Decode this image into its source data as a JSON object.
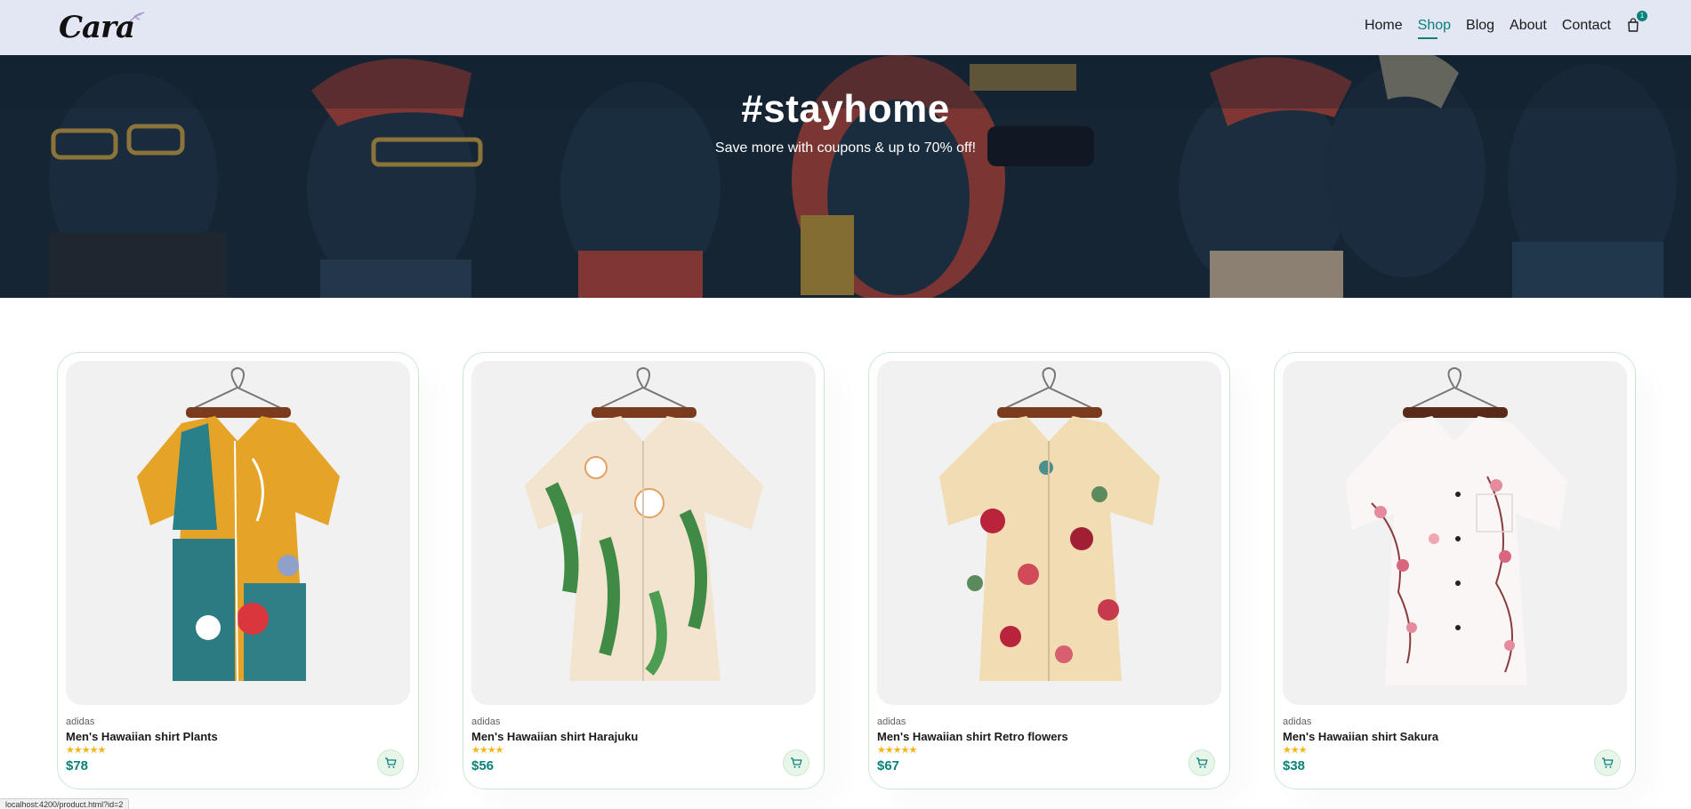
{
  "header": {
    "logo_text": "Cara",
    "nav": [
      "Home",
      "Shop",
      "Blog",
      "About",
      "Contact"
    ],
    "active_nav": "Shop",
    "cart_count": "1"
  },
  "hero": {
    "title": "#stayhome",
    "subtitle": "Save more with coupons & up to 70% off!"
  },
  "products": [
    {
      "brand": "adidas",
      "name": "Men's Hawaiian shirt Plants",
      "rating": 5,
      "stars": "★★★★★",
      "price": "$78"
    },
    {
      "brand": "adidas",
      "name": "Men's Hawaiian shirt Harajuku",
      "rating": 4,
      "stars": "★★★★",
      "price": "$56"
    },
    {
      "brand": "adidas",
      "name": "Men's Hawaiian shirt Retro flowers",
      "rating": 5,
      "stars": "★★★★★",
      "price": "$67"
    },
    {
      "brand": "adidas",
      "name": "Men's Hawaiian shirt Sakura",
      "rating": 3,
      "stars": "★★★",
      "price": "$38"
    }
  ],
  "status_url": "localhost:4200/product.html?id=2",
  "colors": {
    "accent": "#088178",
    "header_bg": "#e3e6f3",
    "star": "#f3b519",
    "hero_bg": "#1b2b3a"
  },
  "icons": [
    "leaf-icon",
    "shopping-bag-icon",
    "cart-icon"
  ]
}
